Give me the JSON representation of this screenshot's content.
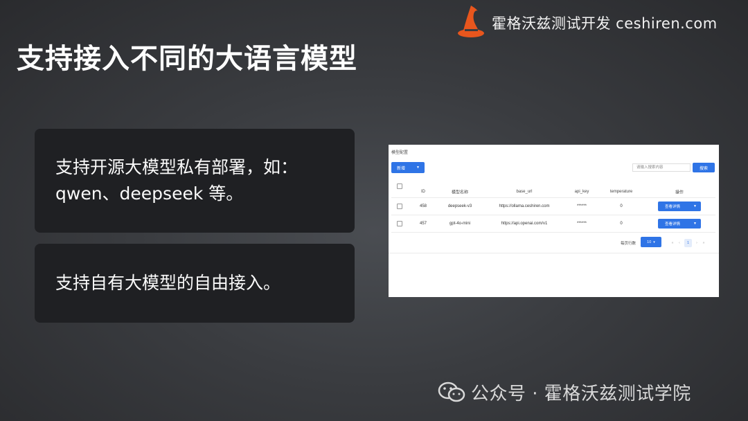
{
  "brand": {
    "text": "霍格沃兹测试开发 ceshiren.com",
    "icon": "wizard-hat-icon",
    "accent": "#e8561d"
  },
  "slide": {
    "title": "支持接入不同的大语言模型",
    "cards": [
      {
        "line1": "支持开源大模型私有部署，如：",
        "line2": "qwen、deepseek 等。"
      },
      {
        "line1": "支持自有大模型的自由接入。"
      }
    ]
  },
  "app": {
    "page_title": "模型配置",
    "new_button": "新增",
    "search_placeholder": "请输入搜索内容",
    "search_button": "搜索",
    "columns": [
      "ID",
      "模型名称",
      "base_url",
      "api_key",
      "temperature",
      "操作"
    ],
    "rows": [
      {
        "id": "458",
        "name": "deepseek-v3",
        "base_url": "https://ollama.ceshiren.com",
        "api_key": "******",
        "temperature": "0",
        "action": "查看详情"
      },
      {
        "id": "457",
        "name": "gpt-4o-mini",
        "base_url": "https://api.openai.com/v1",
        "api_key": "******",
        "temperature": "0",
        "action": "查看详情"
      }
    ],
    "per_page_label": "每页行数",
    "page_size": "10",
    "current_page": "1",
    "accent": "#2f74e6"
  },
  "watermark": {
    "text": "公众号 · 霍格沃兹测试学院",
    "icon": "wechat-icon"
  }
}
